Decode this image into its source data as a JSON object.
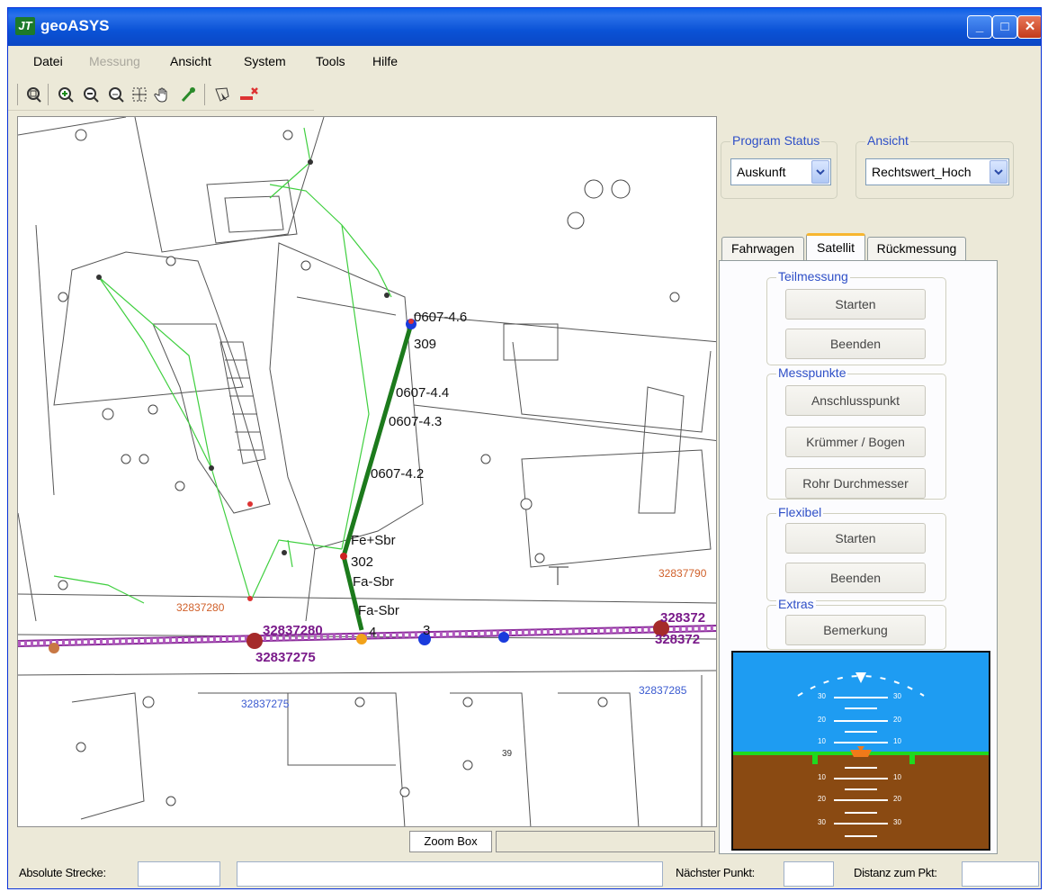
{
  "window": {
    "title": "geoASYS",
    "logo_text": "JT",
    "controls": {
      "minimize": "_",
      "maximize": "□",
      "close": "✕"
    }
  },
  "menu": {
    "items": [
      {
        "label": "Datei",
        "enabled": true
      },
      {
        "label": "Messung",
        "enabled": false
      },
      {
        "label": "Ansicht",
        "enabled": true
      },
      {
        "label": "System",
        "enabled": true
      },
      {
        "label": "Tools",
        "enabled": true
      },
      {
        "label": "Hilfe",
        "enabled": true
      }
    ]
  },
  "toolbar": {
    "icons": [
      "zoom-extent-icon",
      "zoom-in-icon",
      "zoom-out-icon",
      "zoom-previous-icon",
      "zoom-box-icon",
      "pan-hand-icon",
      "add-point-icon",
      "select-area-icon",
      "delete-measure-icon"
    ]
  },
  "map": {
    "labels": {
      "pt_0607_4_6": "0607-4.6",
      "pt_309": "309",
      "pt_0607_4_4": "0607-4.4",
      "pt_0607_4_3": "0607-4.3",
      "pt_0607_4_2": "0607-4.2",
      "fe_sbr": "Fe+Sbr",
      "pt_302": "302",
      "fa_sbr_1": "Fa-Sbr",
      "fa_sbr_2": "Fa-Sbr",
      "pt_4": "4",
      "pt_3": "3",
      "id_32837280": "32837280",
      "id_32837275": "32837275",
      "id_3283727_right": "328372",
      "id_3283728_right": "328372",
      "orange_32837790": "32837790",
      "orange_32837280": "32837280",
      "blue_32837275": "32837275",
      "blue_32837285": "32837285",
      "pt_39": "39"
    }
  },
  "zoom": {
    "label": "Zoom Box"
  },
  "program_status": {
    "title": "Program Status",
    "value": "Auskunft"
  },
  "ansicht": {
    "title": "Ansicht",
    "value": "Rechtswert_Hoch"
  },
  "tabs": [
    {
      "label": "Fahrwagen",
      "active": false
    },
    {
      "label": "Satellit",
      "active": true
    },
    {
      "label": "Rückmessung",
      "active": false
    }
  ],
  "panel": {
    "teilmessung": {
      "title": "Teilmessung",
      "start": "Starten",
      "end": "Beenden"
    },
    "messpunkte": {
      "title": "Messpunkte",
      "anschluss": "Anschlusspunkt",
      "kruemmer": "Krümmer / Bogen",
      "rohr": "Rohr Durchmesser"
    },
    "flexibel": {
      "title": "Flexibel",
      "start": "Starten",
      "end": "Beenden"
    },
    "extras": {
      "title": "Extras",
      "bemerkung": "Bemerkung"
    },
    "horizon_ticks": [
      "30",
      "30",
      "20",
      "20",
      "10",
      "10",
      "10",
      "10",
      "20",
      "20",
      "30",
      "30"
    ],
    "colors": {
      "sky": "#1e9cf2",
      "ground": "#8a4a12",
      "horizon_line": "#1fd91f",
      "marker": "#f07a1a"
    }
  },
  "statusbar": {
    "absolute_strecke": "Absolute Strecke:",
    "naechster_punkt": "Nächster Punkt:",
    "distanz": "Distanz zum Pkt:"
  }
}
